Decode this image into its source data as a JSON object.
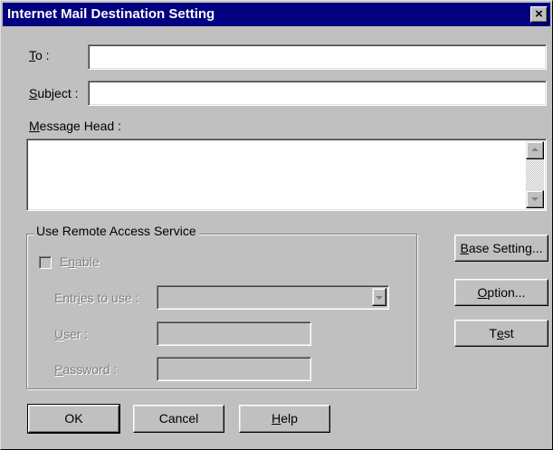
{
  "window": {
    "title": "Internet Mail Destination Setting",
    "close_glyph": "×"
  },
  "fields": {
    "to": {
      "label_access": "T",
      "label_rest": "o :",
      "value": ""
    },
    "subject": {
      "label_access": "S",
      "label_rest": "ubject :",
      "value": ""
    },
    "message_head": {
      "label_access": "M",
      "label_rest": "essage Head :",
      "value": ""
    }
  },
  "remote_access": {
    "group_title": "Use Remote Access Service",
    "enable": {
      "pre": "E",
      "access": "n",
      "post": "able",
      "checked": false
    },
    "entries": {
      "pre": "Entr",
      "access": "i",
      "post": "es to use :",
      "value": ""
    },
    "user": {
      "access": "U",
      "post": "ser :",
      "value": ""
    },
    "password": {
      "access": "P",
      "post": "assword :",
      "value": ""
    }
  },
  "side_buttons": {
    "base_setting": {
      "access": "B",
      "post": "ase Setting..."
    },
    "option": {
      "access": "O",
      "post": "ption..."
    },
    "test": {
      "pre": "T",
      "access": "e",
      "post": "st"
    }
  },
  "bottom_buttons": {
    "ok": "OK",
    "cancel": "Cancel",
    "help": {
      "access": "H",
      "post": "elp"
    }
  },
  "icons": {
    "close": "close-icon",
    "scroll_up": "arrow-up-icon",
    "scroll_down": "arrow-down-icon",
    "dropdown": "chevron-down-icon"
  },
  "colors": {
    "face": "#c0c0c0",
    "titlebar": "#000080",
    "disabled_text": "#808080"
  }
}
